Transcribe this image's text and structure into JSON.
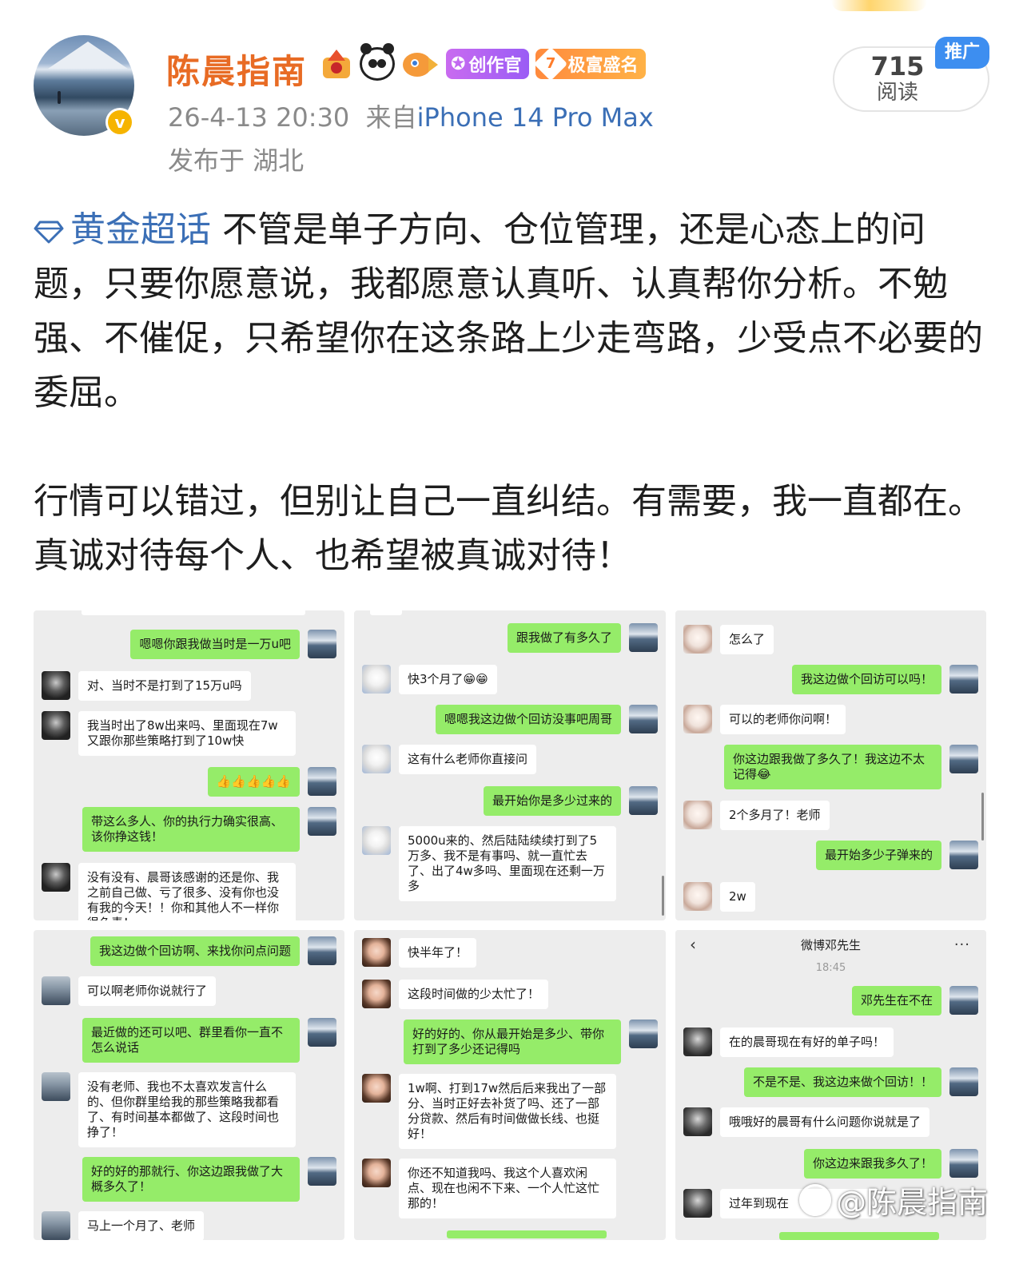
{
  "header": {
    "username": "陈晨指南",
    "badges": {
      "creator": "创作官",
      "rich_level": "7",
      "rich_label": "极富盛名"
    },
    "time": "26-4-13 20:30",
    "from_label": "来自",
    "device": "iPhone 14 Pro Max",
    "location": "发布于 湖北",
    "reads_count": "715",
    "reads_label": "阅读",
    "promo_label": "推广"
  },
  "post": {
    "topic": "黄金超话",
    "paragraph1": "不管是单子方向、仓位管理，还是心态上的问题，只要你愿意说，我都愿意认真听、认真帮你分析。不勉强、不催促，只希望你在这条路上少走弯路，少受点不必要的委屈。",
    "paragraph2": "行情可以错过，但别让自己一直纠结。有需要，我一直都在。真诚对待每个人、也希望被真诚对待！"
  },
  "screenshots": {
    "s1": [
      {
        "side": "out",
        "text": "嗯嗯你跟我做当时是一万u吧"
      },
      {
        "side": "in",
        "text": "对、当时不是打到了15万u吗"
      },
      {
        "side": "in",
        "text": "我当时出了8w出来吗、里面现在7w又跟你那些策略打到了10w快"
      },
      {
        "side": "out",
        "text": "👍👍👍👍👍"
      },
      {
        "side": "out",
        "text": "带这么多人、你的执行力确实很高、该你挣这钱！"
      },
      {
        "side": "in",
        "text": "没有没有、晨哥该感谢的还是你、我之前自己做、亏了很多、没有你也没有我的今天！！你和其他人不一样你很负责！"
      }
    ],
    "s2": [
      {
        "side": "out",
        "text": "跟我做了有多久了"
      },
      {
        "side": "in",
        "text": "快3个月了😁😁"
      },
      {
        "side": "out",
        "text": "嗯嗯我这边做个回访没事吧周哥"
      },
      {
        "side": "in",
        "text": "这有什么老师你直接问"
      },
      {
        "side": "out",
        "text": "最开始你是多少过来的"
      },
      {
        "side": "in",
        "text": "5000u来的、然后陆陆续续打到了5万多、我不是有事吗、就一直忙去了、出了4w多吗、里面现在还剩一万多"
      }
    ],
    "s3": [
      {
        "side": "in",
        "text": "怎么了"
      },
      {
        "side": "out",
        "text": "我这边做个回访可以吗！"
      },
      {
        "side": "in",
        "text": "可以的老师你问啊！"
      },
      {
        "side": "out",
        "text": "你这边跟我做了多久了！我这边不太记得😂"
      },
      {
        "side": "in",
        "text": "2个多月了！老师"
      },
      {
        "side": "out",
        "text": "最开始多少子弹来的"
      },
      {
        "side": "in",
        "text": "2w"
      }
    ],
    "s4": [
      {
        "side": "out",
        "text": "我这边做个回访啊、来找你问点问题"
      },
      {
        "side": "in",
        "text": "可以啊老师你说就行了"
      },
      {
        "side": "out",
        "text": "最近做的还可以吧、群里看你一直不怎么说话"
      },
      {
        "side": "in",
        "text": "没有老师、我也不太喜欢发言什么的、但你群里给我的那些策略我都看了、有时间基本都做了、这段时间也挣了！"
      },
      {
        "side": "out",
        "text": "好的好的那就行、你这边跟我做了大概多久了！"
      },
      {
        "side": "in",
        "text": "马上一个月了、老师"
      }
    ],
    "s5": [
      {
        "side": "in",
        "text": "快半年了！"
      },
      {
        "side": "in",
        "text": "这段时间做的少太忙了！"
      },
      {
        "side": "out",
        "text": "好的好的、你从最开始是多少、带你打到了多少还记得吗"
      },
      {
        "side": "in",
        "text": "1w啊、打到17w然后后来我出了一部分、当时正好去补货了吗、还了一部分贷款、然后有时间做做长线、也挺好！"
      },
      {
        "side": "in",
        "text": "你还不知道我吗、我这个人喜欢闲点、现在也闲不下来、一个人忙这忙那的！"
      }
    ],
    "s6": {
      "title": "微博邓先生",
      "time": "18:45",
      "messages": [
        {
          "side": "out",
          "text": "邓先生在不在"
        },
        {
          "side": "in",
          "text": "在的晨哥现在有好的单子吗！"
        },
        {
          "side": "out",
          "text": "不是不是、我这边来做个回访！！"
        },
        {
          "side": "in",
          "text": "哦哦好的晨哥有什么问题你说就是了"
        },
        {
          "side": "out",
          "text": "你这边来跟我多久了！"
        },
        {
          "side": "in",
          "text": "过年到现在"
        }
      ]
    }
  },
  "watermark": "@陈晨指南"
}
